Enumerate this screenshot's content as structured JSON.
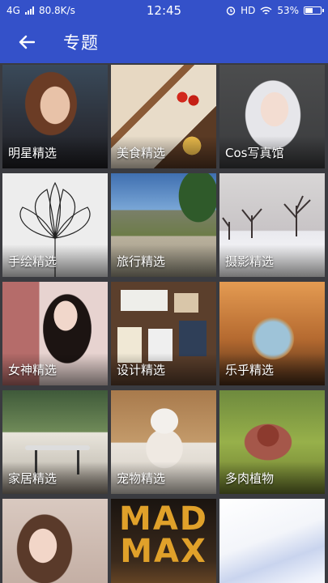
{
  "status_bar": {
    "network": "4G",
    "speed": "80.8K/s",
    "time": "12:45",
    "hd": "HD",
    "battery": "53%",
    "battery_level": 0.53
  },
  "app_bar": {
    "title": "专题"
  },
  "tiles": [
    {
      "label": "明星精选"
    },
    {
      "label": "美食精选"
    },
    {
      "label": "Cos写真馆"
    },
    {
      "label": "手绘精选"
    },
    {
      "label": "旅行精选"
    },
    {
      "label": "摄影精选"
    },
    {
      "label": "女神精选"
    },
    {
      "label": "设计精选"
    },
    {
      "label": "乐乎精选"
    },
    {
      "label": "家居精选"
    },
    {
      "label": "宠物精选"
    },
    {
      "label": "多肉植物"
    },
    {
      "label": ""
    },
    {
      "label": ""
    },
    {
      "label": ""
    }
  ],
  "poster_text": {
    "line1": "MAD",
    "line2": "MAX"
  }
}
